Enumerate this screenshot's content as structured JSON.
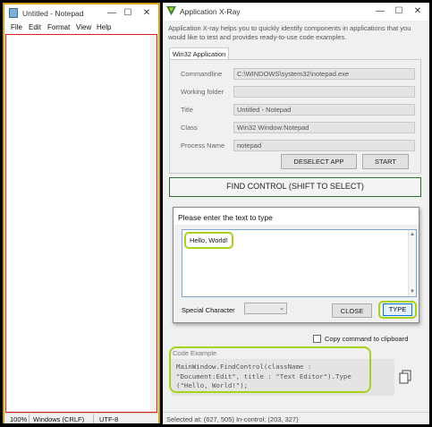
{
  "notepad": {
    "title": "Untitled - Notepad",
    "menu": [
      "File",
      "Edit",
      "Format",
      "View",
      "Help"
    ],
    "status": {
      "zoom": "100%",
      "line_ending": "Windows (CRLF)",
      "encoding": "UTF-8"
    }
  },
  "xray": {
    "title": "Application X-Ray",
    "description": "Application X-ray helps you to quickly identify components in applications that you would like to test and provides ready-to-use code examples.",
    "tab_label": "Win32 Application",
    "fields": [
      {
        "label": "Commandline",
        "value": "C:\\WINDOWS\\system32\\notepad.exe"
      },
      {
        "label": "Working folder",
        "value": ""
      },
      {
        "label": "Title",
        "value": "Untitled - Notepad"
      },
      {
        "label": "Class",
        "value": "Win32 Window:Notepad"
      },
      {
        "label": "Process Name",
        "value": "notepad"
      }
    ],
    "deselect_label": "DESELECT APP",
    "start_label": "START",
    "find_label": "FIND CONTROL (SHIFT TO SELECT)",
    "dialog": {
      "title": "Please enter the text  to type",
      "text_value": "Hello, World!",
      "special_label": "Special Character",
      "special_value": "",
      "close_label": "CLOSE",
      "type_label": "TYPE"
    },
    "copy_checkbox_label": "Copy command to clipboard",
    "code_label": "Code Example",
    "code_text": "MainWindow.FindControl(className : \"Document:Edit\", title : \"Text Editor\").Type (\"Hello, World!\");",
    "status_text": "Selected at: (627, 505) In-control: (203, 327)"
  },
  "colors": {
    "notepad_border": "#d4a017",
    "edit_border": "#e02020",
    "highlight_ring": "#a6d21c",
    "find_border": "#2e6b2e",
    "focus_blue": "#0078d7"
  }
}
